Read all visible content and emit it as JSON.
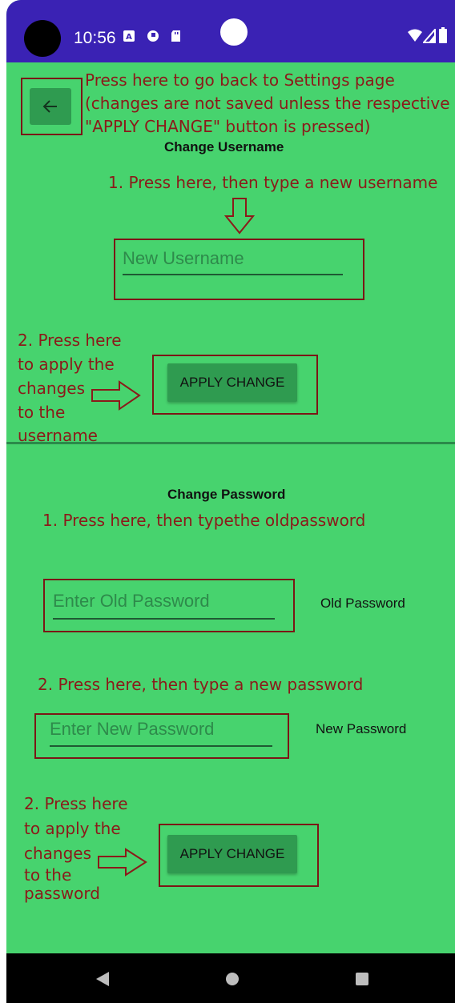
{
  "status_bar": {
    "time": "10:56",
    "icons": [
      "a-notification-icon",
      "circle-notification-icon",
      "sd-card-icon",
      "wifi-icon",
      "signal-icon",
      "battery-icon"
    ]
  },
  "annotations": {
    "back": [
      "Press here to go back to Settings page",
      "(changes are not saved unless the respective",
      "\"APPLY CHANGE\" button is pressed)"
    ],
    "username_step1": "1. Press here, then type a new username",
    "username_step2": [
      "2. Press here",
      "to apply the",
      "changes",
      "to the",
      "username"
    ],
    "password_step1": "1. Press here, then typethe oldpassword",
    "password_step2": "2. Press here, then type a new password",
    "password_step3": [
      "2. Press here",
      "to apply the",
      "changes",
      "to the",
      "password"
    ]
  },
  "username_section": {
    "title": "Change Username",
    "placeholder": "New Username",
    "apply_label": "APPLY CHANGE"
  },
  "password_section": {
    "title": "Change Password",
    "old_placeholder": "Enter Old Password",
    "old_label": "Old Password",
    "new_placeholder": "Enter New Password",
    "new_label": "New Password",
    "apply_label": "APPLY CHANGE"
  },
  "colors": {
    "background": "#47d36e",
    "status_bar": "#3a22b4",
    "button": "#2f9b50",
    "annotation": "#8b1a1a"
  }
}
